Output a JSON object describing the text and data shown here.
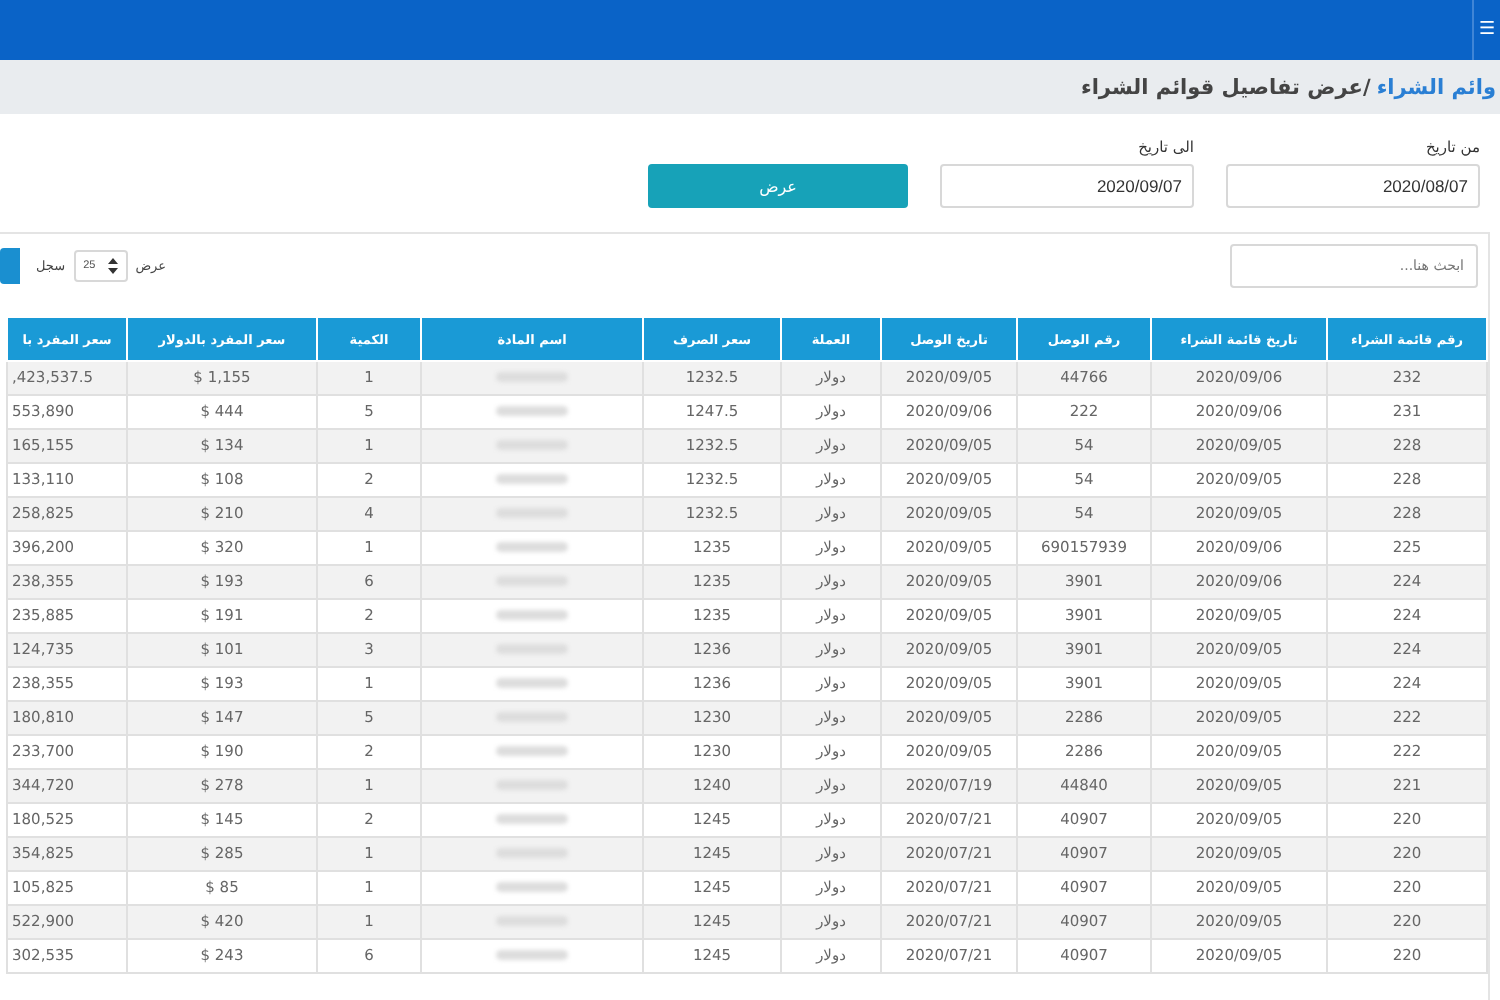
{
  "top_bar": {
    "menu_glyph": "☰"
  },
  "breadcrumb": {
    "link": "وائم الشراء",
    "current": "/عرض تفاصيل قوائم الشراء"
  },
  "filters": {
    "from_label": "من تاريخ",
    "from_value": "2020/08/07",
    "to_label": "الى تاريخ",
    "to_value": "2020/09/07",
    "submit": "عرض"
  },
  "toolbar": {
    "search_placeholder": "ابحث هنا...",
    "show_label": "عرض",
    "page_size": "25",
    "records_label": "سجل"
  },
  "table": {
    "columns": [
      "سعر المفرد با",
      "سعر المفرد بالدولار",
      "الكمية",
      "اسم المادة",
      "سعر الصرف",
      "العملة",
      "تاريخ الوصل",
      "رقم الوصل",
      "تاريخ قائمة الشراء",
      "رقم قائمة الشراء"
    ],
    "rows": [
      [
        ",423,537.5",
        "$ 1,155",
        "1",
        "",
        "1232.5",
        "دولار",
        "2020/09/05",
        "44766",
        "2020/09/06",
        "232"
      ],
      [
        "553,890",
        "$ 444",
        "5",
        "",
        "1247.5",
        "دولار",
        "2020/09/06",
        "222",
        "2020/09/06",
        "231"
      ],
      [
        "165,155",
        "$ 134",
        "1",
        "",
        "1232.5",
        "دولار",
        "2020/09/05",
        "54",
        "2020/09/05",
        "228"
      ],
      [
        "133,110",
        "$ 108",
        "2",
        "",
        "1232.5",
        "دولار",
        "2020/09/05",
        "54",
        "2020/09/05",
        "228"
      ],
      [
        "258,825",
        "$ 210",
        "4",
        "",
        "1232.5",
        "دولار",
        "2020/09/05",
        "54",
        "2020/09/05",
        "228"
      ],
      [
        "396,200",
        "$ 320",
        "1",
        "",
        "1235",
        "دولار",
        "2020/09/05",
        "690157939",
        "2020/09/06",
        "225"
      ],
      [
        "238,355",
        "$ 193",
        "6",
        "",
        "1235",
        "دولار",
        "2020/09/05",
        "3901",
        "2020/09/06",
        "224"
      ],
      [
        "235,885",
        "$ 191",
        "2",
        "",
        "1235",
        "دولار",
        "2020/09/05",
        "3901",
        "2020/09/05",
        "224"
      ],
      [
        "124,735",
        "$ 101",
        "3",
        "",
        "1236",
        "دولار",
        "2020/09/05",
        "3901",
        "2020/09/05",
        "224"
      ],
      [
        "238,355",
        "$ 193",
        "1",
        "",
        "1236",
        "دولار",
        "2020/09/05",
        "3901",
        "2020/09/05",
        "224"
      ],
      [
        "180,810",
        "$ 147",
        "5",
        "",
        "1230",
        "دولار",
        "2020/09/05",
        "2286",
        "2020/09/05",
        "222"
      ],
      [
        "233,700",
        "$ 190",
        "2",
        "",
        "1230",
        "دولار",
        "2020/09/05",
        "2286",
        "2020/09/05",
        "222"
      ],
      [
        "344,720",
        "$ 278",
        "1",
        "",
        "1240",
        "دولار",
        "2020/07/19",
        "44840",
        "2020/09/05",
        "221"
      ],
      [
        "180,525",
        "$ 145",
        "2",
        "",
        "1245",
        "دولار",
        "2020/07/21",
        "40907",
        "2020/09/05",
        "220"
      ],
      [
        "354,825",
        "$ 285",
        "1",
        "",
        "1245",
        "دولار",
        "2020/07/21",
        "40907",
        "2020/09/05",
        "220"
      ],
      [
        "105,825",
        "$ 85",
        "1",
        "",
        "1245",
        "دولار",
        "2020/07/21",
        "40907",
        "2020/09/05",
        "220"
      ],
      [
        "522,900",
        "$ 420",
        "1",
        "",
        "1245",
        "دولار",
        "2020/07/21",
        "40907",
        "2020/09/05",
        "220"
      ],
      [
        "302,535",
        "$ 243",
        "6",
        "",
        "1245",
        "دولار",
        "2020/07/21",
        "40907",
        "2020/09/05",
        "220"
      ]
    ]
  }
}
